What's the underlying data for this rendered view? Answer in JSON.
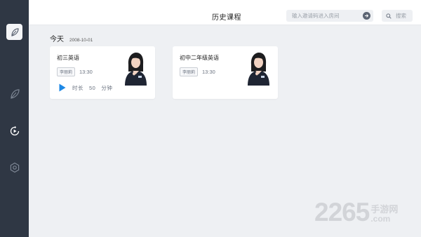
{
  "header": {
    "title": "历史课程",
    "invite_placeholder": "输入邀请码进入房间",
    "search_label": "搜索"
  },
  "sidebar": {
    "icons": [
      "leaf-logo-icon",
      "leaf-icon",
      "history-play-icon",
      "settings-hexagon-icon"
    ]
  },
  "section": {
    "title": "今天",
    "date": "2008-10-01"
  },
  "courses": [
    {
      "name": "初三英语",
      "teacher": "李丽莉",
      "time": "13:30",
      "duration_prefix": "时长",
      "duration_value": "50",
      "duration_unit": "分钟"
    },
    {
      "name": "初中二年级英语",
      "teacher": "李丽莉",
      "time": "13:30"
    }
  ],
  "watermark": {
    "number": "2265",
    "cn": "手游网",
    "domain": ".com"
  },
  "colors": {
    "sidebar": "#2f3744",
    "background": "#eef0f3",
    "play_accent": "#1e88e5"
  }
}
